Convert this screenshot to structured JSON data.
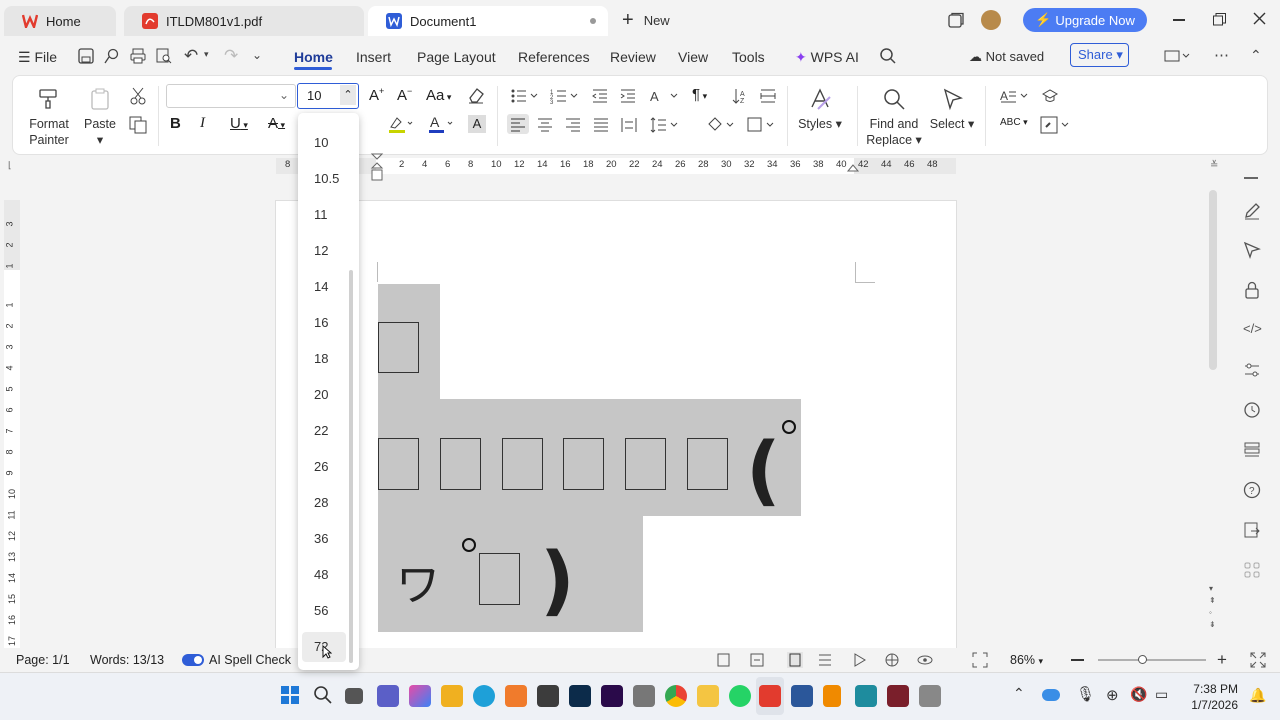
{
  "tabs": [
    {
      "label": "Home"
    },
    {
      "label": "ITLDM801v1.pdf"
    },
    {
      "label": "Document1"
    }
  ],
  "new_tab": "New",
  "upgrade": "Upgrade Now",
  "menu": {
    "file": "File",
    "items": [
      "Home",
      "Insert",
      "Page Layout",
      "References",
      "Review",
      "View",
      "Tools"
    ],
    "wps_ai": "WPS AI",
    "not_saved": "Not saved",
    "share": "Share"
  },
  "ribbon": {
    "format_painter": [
      "Format",
      "Painter"
    ],
    "paste": "Paste",
    "styles": "Styles",
    "find_replace": [
      "Find and",
      "Replace"
    ],
    "select": "Select",
    "font_size": "10",
    "font_name": ""
  },
  "font_size_options": [
    "10",
    "10.5",
    "11",
    "12",
    "14",
    "16",
    "18",
    "20",
    "22",
    "26",
    "28",
    "36",
    "48",
    "56",
    "72"
  ],
  "hovered_font_size": "72",
  "ruler": {
    "numbers": [
      "8",
      "2",
      "4",
      "6",
      "8",
      "10",
      "12",
      "14",
      "16",
      "18",
      "20",
      "22",
      "24",
      "26",
      "28",
      "30",
      "32",
      "34",
      "36",
      "38",
      "40",
      "42",
      "44",
      "46",
      "48"
    ],
    "vertical": [
      "3",
      "2",
      "1",
      "1",
      "2",
      "3",
      "4",
      "5",
      "6",
      "7",
      "8",
      "9",
      "10",
      "11",
      "12",
      "13",
      "14",
      "15",
      "16",
      "17"
    ]
  },
  "document": {
    "paren_open": "(",
    "paren_close": ")",
    "kana": "ワ",
    "degree": "°"
  },
  "status": {
    "page": "Page: 1/1",
    "words": "Words: 13/13",
    "spell": "AI Spell Check",
    "zoom": "86%"
  },
  "taskbar": {
    "time": "7:38 PM",
    "date": "1/7/2026"
  },
  "colors": {
    "accent": "#2f5dd7",
    "upgrade": "#4c7cf3",
    "doc_highlight": "#c6c6c6",
    "wps_red": "#e23b2e"
  }
}
